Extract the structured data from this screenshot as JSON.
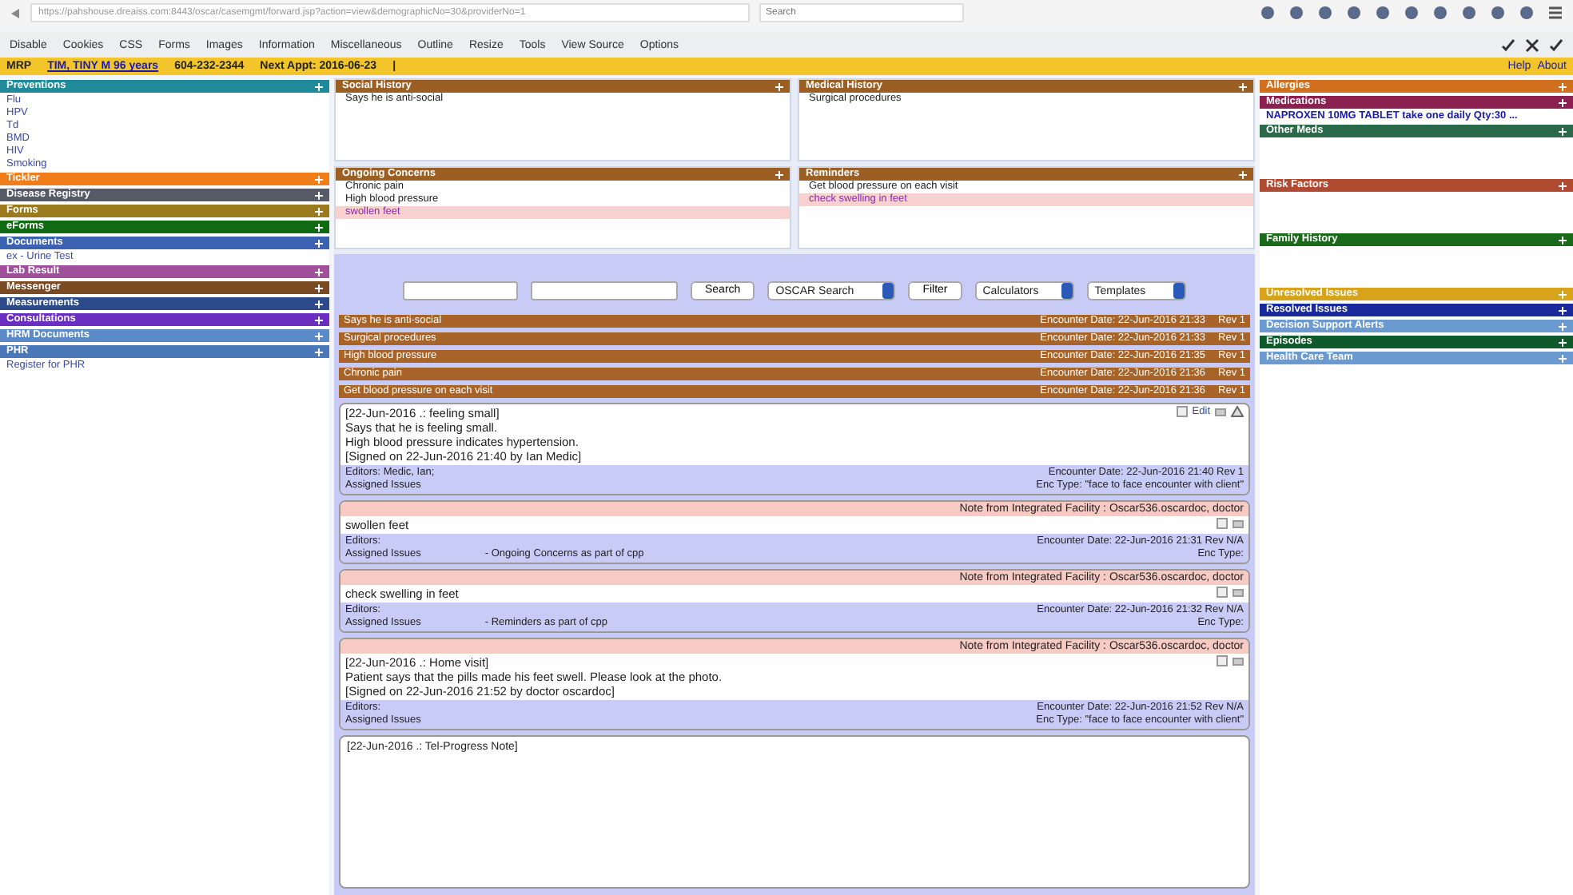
{
  "browser": {
    "url": "https://pahshouse.dreaiss.com:8443/oscar/casemgmt/forward.jsp?action=view&demographicNo=30&providerNo=1",
    "search_placeholder": "Search"
  },
  "devtoolbar": {
    "menus": [
      "Disable",
      "Cookies",
      "CSS",
      "Forms",
      "Images",
      "Information",
      "Miscellaneous",
      "Outline",
      "Resize",
      "Tools",
      "View Source",
      "Options"
    ]
  },
  "patient_bar": {
    "mrp": "MRP",
    "name": "TIM, TINY M 96 years",
    "phone": "604-232-2344",
    "next_appt": "Next Appt: 2016-06-23",
    "separator": "|",
    "links": [
      "Help",
      "About"
    ]
  },
  "left_sidebar": [
    {
      "title": "Preventions",
      "color": "#1f8a9a",
      "items": [
        "Flu",
        "HPV",
        "Td",
        "BMD",
        "HIV",
        "Smoking"
      ]
    },
    {
      "title": "Tickler",
      "color": "#f07c1a"
    },
    {
      "title": "Disease Registry",
      "color": "#555a66"
    },
    {
      "title": "Forms",
      "color": "#9a7a1c"
    },
    {
      "title": "eForms",
      "color": "#0f6a12"
    },
    {
      "title": "Documents",
      "color": "#3a62b0",
      "items": [
        "ex - Urine Test"
      ]
    },
    {
      "title": "Lab Result",
      "color": "#a0509a"
    },
    {
      "title": "Messenger",
      "color": "#7a4a22"
    },
    {
      "title": "Measurements",
      "color": "#2c4a8a"
    },
    {
      "title": "Consultations",
      "color": "#6a2ec0"
    },
    {
      "title": "HRM Documents",
      "color": "#5a8ac8"
    },
    {
      "title": "PHR",
      "color": "#4a78b8",
      "items": [
        "Register for PHR"
      ]
    }
  ],
  "cpp_panels": [
    {
      "title": "Social History",
      "items": [
        {
          "text": "Says he is anti-social",
          "highlighted": false
        }
      ]
    },
    {
      "title": "Medical History",
      "items": [
        {
          "text": "Surgical procedures",
          "highlighted": false
        }
      ]
    },
    {
      "title": "Ongoing Concerns",
      "items": [
        {
          "text": "Chronic pain",
          "highlighted": false
        },
        {
          "text": "High blood pressure",
          "highlighted": false
        },
        {
          "text": "swollen feet",
          "highlighted": true
        }
      ]
    },
    {
      "title": "Reminders",
      "items": [
        {
          "text": "Get blood pressure on each visit",
          "highlighted": false
        },
        {
          "text": "check swelling in feet",
          "highlighted": true
        }
      ]
    }
  ],
  "search_row": {
    "search_button": "Search",
    "oscar_search": "OSCAR Search",
    "filter_button": "Filter",
    "calculators": "Calculators",
    "templates": "Templates"
  },
  "issue_rows": [
    {
      "text": "Says he is anti-social",
      "date": "Encounter Date: 22-Jun-2016 21:33",
      "rev": "Rev 1"
    },
    {
      "text": "Surgical procedures",
      "date": "Encounter Date: 22-Jun-2016 21:33",
      "rev": "Rev 1"
    },
    {
      "text": "High blood pressure",
      "date": "Encounter Date: 22-Jun-2016 21:35",
      "rev": "Rev 1"
    },
    {
      "text": "Chronic pain",
      "date": "Encounter Date: 22-Jun-2016 21:36",
      "rev": "Rev 1"
    },
    {
      "text": "Get blood pressure on each visit",
      "date": "Encounter Date: 22-Jun-2016 21:36",
      "rev": "Rev 1"
    }
  ],
  "notes": [
    {
      "remote": false,
      "lines": [
        "[22-Jun-2016 .: feeling small]",
        "Says that he is feeling small.",
        "High blood pressure indicates hypertension.",
        "[Signed on 22-Jun-2016 21:40 by Ian Medic]"
      ],
      "edit": "Edit",
      "editors": "Editors: Medic, Ian;",
      "assigned": "Assigned Issues",
      "date": "Encounter Date: 22-Jun-2016 21:40  Rev 1",
      "type": "Enc Type: \"face to face encounter with client\""
    },
    {
      "remote": true,
      "header": "Note from Integrated Facility : Oscar536.oscardoc, doctor",
      "lines": [
        "swollen feet"
      ],
      "editors": "Editors:",
      "assigned": "Assigned Issues",
      "issue": "- Ongoing Concerns as part of cpp",
      "date": "Encounter Date: 22-Jun-2016 21:31  Rev N/A",
      "type": "Enc Type:"
    },
    {
      "remote": true,
      "header": "Note from Integrated Facility : Oscar536.oscardoc, doctor",
      "lines": [
        "check swelling in feet"
      ],
      "editors": "Editors:",
      "assigned": "Assigned Issues",
      "issue": "- Reminders as part of cpp",
      "date": "Encounter Date: 22-Jun-2016 21:32  Rev N/A",
      "type": "Enc Type:"
    },
    {
      "remote": true,
      "header": "Note from Integrated Facility : Oscar536.oscardoc, doctor",
      "lines": [
        "[22-Jun-2016 .: Home visit]",
        "Patient says that the pills made his feet swell. Please look at the photo.",
        "[Signed on 22-Jun-2016 21:52 by doctor oscardoc]"
      ],
      "editors": "Editors:",
      "assigned": "Assigned Issues",
      "date": "Encounter Date: 22-Jun-2016 21:52  Rev N/A",
      "type": "Enc Type: \"face to face encounter with client\""
    }
  ],
  "new_note": {
    "value": "[22-Jun-2016 .: Tel-Progress Note]"
  },
  "right_sidebar": [
    {
      "title": "Allergies",
      "color": "#d0701e"
    },
    {
      "title": "Medications",
      "color": "#8a2050",
      "items": [
        "NAPROXEN 10MG TABLET take one daily Qty:30 ..."
      ]
    },
    {
      "title": "Other Meds",
      "color": "#2a6a4a"
    },
    {
      "title": "Risk Factors",
      "color": "#b04a30"
    },
    {
      "title": "Family History",
      "color": "#1a6a1a"
    },
    {
      "title": "Unresolved Issues",
      "color": "#d8a21a"
    },
    {
      "title": "Resolved Issues",
      "color": "#1a2a9a"
    },
    {
      "title": "Decision Support Alerts",
      "color": "#6a9ad0"
    },
    {
      "title": "Episodes",
      "color": "#0f5a2a"
    },
    {
      "title": "Health Care Team",
      "color": "#6a9ad0"
    }
  ]
}
